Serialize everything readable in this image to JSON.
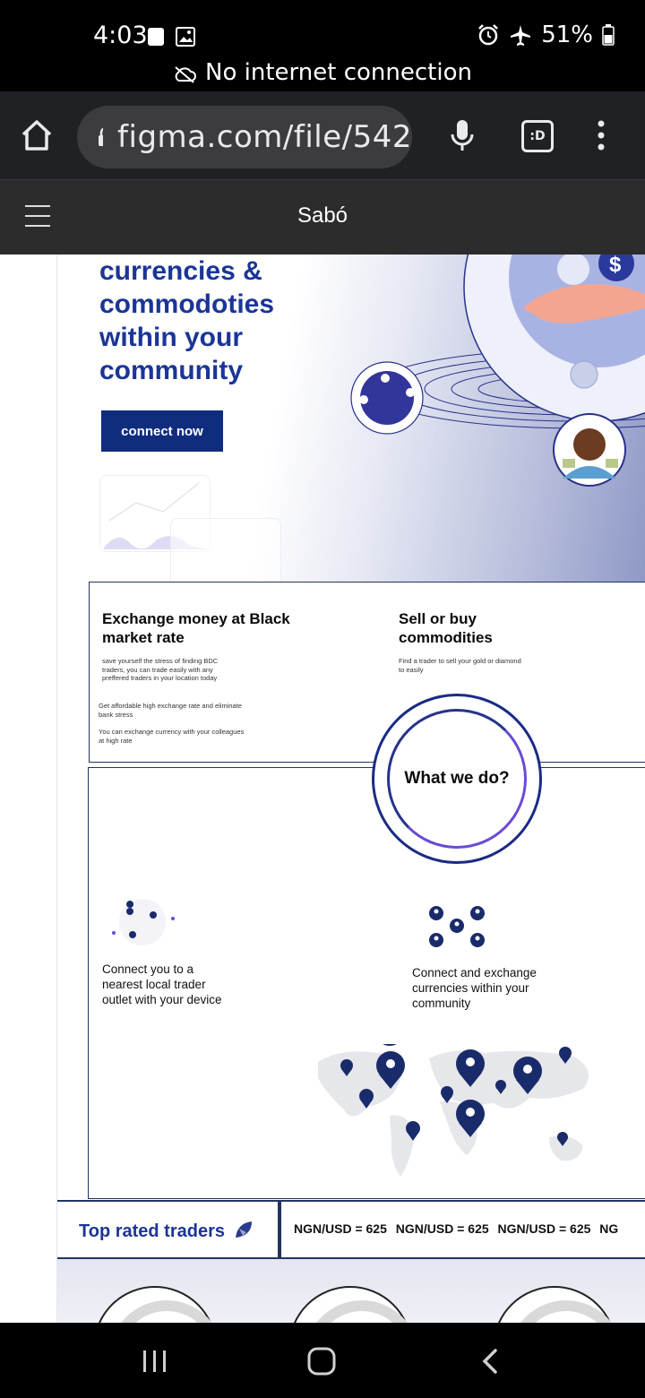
{
  "status_bar": {
    "time": "4:03",
    "battery": "51%",
    "connection_notice": "No internet connection"
  },
  "browser": {
    "url": "figma.com/file/542",
    "tab_switcher_label": ":D"
  },
  "figma": {
    "file_title": "Sabó"
  },
  "hero": {
    "title": "currencies & commodoties within your community",
    "cta_label": "connect now"
  },
  "services": {
    "exchange": {
      "title": "Exchange money at Black market rate",
      "body1": "save yourself the stress of finding BDC traders,  you can trade easily with any preffered traders in your location today",
      "body2": "Get  affordable high exchange rate and eliminate bank stress",
      "body3": "You can exchange currency with your colleagues at high rate"
    },
    "commodities": {
      "title": "Sell or buy commodities",
      "body": "Find a trader to sell your gold or diamond  to easily"
    }
  },
  "what_we_do": {
    "label": "What we do?",
    "feature_left": "Connect you to a nearest local trader outlet with your device",
    "feature_right": "Connect and exchange currencies within your community"
  },
  "ticker": {
    "heading": "Top rated traders",
    "rates": [
      "NGN/USD = 625",
      "NGN/USD = 625",
      "NGN/USD = 625",
      "NG"
    ]
  },
  "colors": {
    "brand_blue": "#1b3597",
    "button_navy": "#0f2c7d",
    "accent_purple": "#6a4bd4"
  }
}
